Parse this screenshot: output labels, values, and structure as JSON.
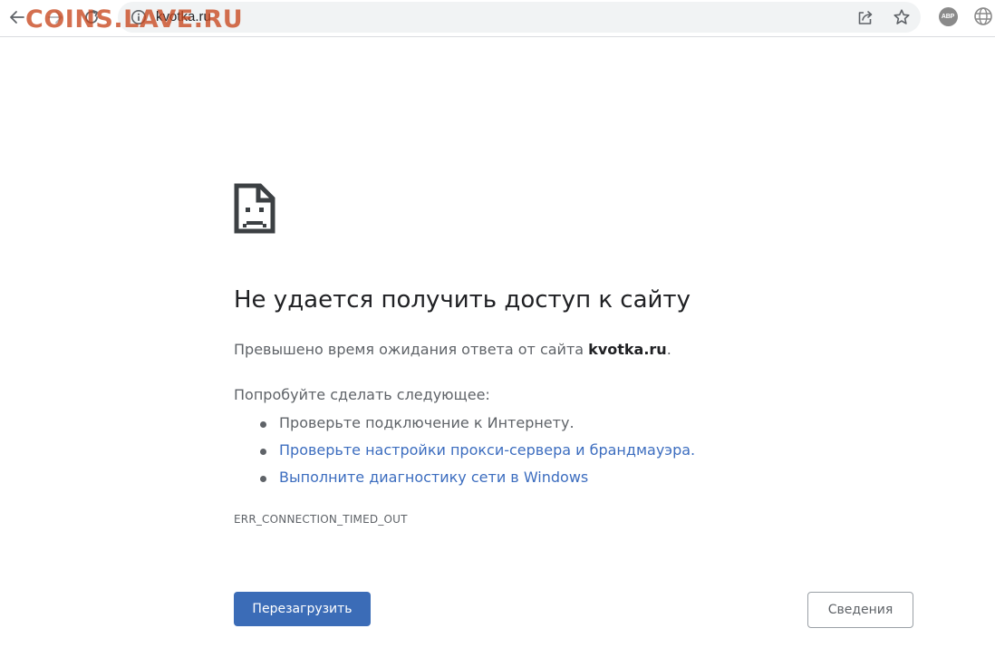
{
  "toolbar": {
    "url": "kvotka.ru"
  },
  "watermark": "COINS.LAVE.RU",
  "extensions": {
    "abp_label": "ABP"
  },
  "error_page": {
    "title": "Не удается получить доступ к сайту",
    "desc_prefix": "Превышено время ожидания ответа от сайта ",
    "desc_host": "kvotka.ru",
    "desc_suffix": ".",
    "suggestions_heading": "Попробуйте сделать следующее:",
    "suggestions": [
      {
        "label": "Проверьте подключение к Интернету.",
        "link": false
      },
      {
        "label": "Проверьте настройки прокси-сервера и брандмауэра.",
        "link": true
      },
      {
        "label": "Выполните диагностику сети в Windows",
        "link": true
      }
    ],
    "error_code": "ERR_CONNECTION_TIMED_OUT",
    "reload_label": "Перезагрузить",
    "details_label": "Сведения"
  },
  "colors": {
    "link": "#3c6dbf",
    "primary_button": "#3b6cb7",
    "text_secondary": "#5f6368",
    "text_primary": "#202124"
  }
}
